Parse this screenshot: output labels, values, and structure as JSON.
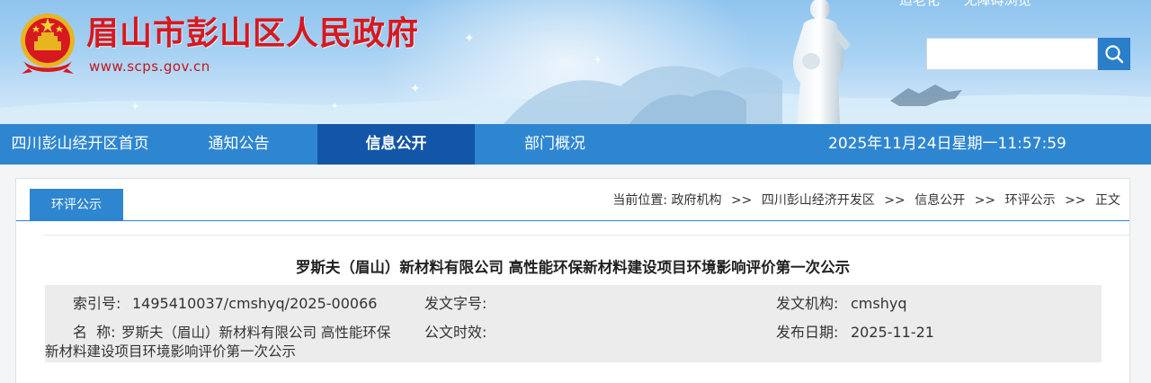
{
  "header": {
    "site_title": "眉山市彭山区人民政府",
    "site_url": "www.scps.gov.cn",
    "top_links": [
      "适老化",
      "无障碍浏览"
    ],
    "search": {
      "value": "",
      "placeholder": ""
    }
  },
  "nav": {
    "items": [
      {
        "label": "四川彭山经开区首页",
        "active": false
      },
      {
        "label": "通知公告",
        "active": false
      },
      {
        "label": "信息公开",
        "active": true
      },
      {
        "label": "部门概况",
        "active": false
      }
    ],
    "datetime": "2025年11月24日星期一11:57:59"
  },
  "content": {
    "tab_label": "环评公示",
    "breadcrumb": {
      "prefix": "当前位置:",
      "items": [
        "政府机构",
        "四川彭山经济开发区",
        "信息公开",
        "环评公示",
        "正文"
      ],
      "separator": ">>"
    },
    "title": "罗斯夫（眉山）新材料有限公司 高性能环保新材料建设项目环境影响评价第一次公示",
    "meta": {
      "index_label": "索引号:",
      "index_value": "1495410037/cmshyq/2025-00066",
      "doc_no_label": "发文字号:",
      "doc_no_value": "",
      "issuer_label": "发文机构:",
      "issuer_value": "cmshyq",
      "name_label": "名  称:",
      "name_value": "罗斯夫（眉山）新材料有限公司 高性能环保新材料建设项目环境影响评价第一次公示",
      "validity_label": "公文时效:",
      "validity_value": "",
      "date_label": "发布日期:",
      "date_value": "2025-11-21"
    }
  },
  "colors": {
    "brand_red": "#d7181f",
    "nav_blue": "#2e86d1",
    "nav_active": "#1356a8",
    "meta_bg": "#ececec"
  },
  "icons": [
    "national-emblem-icon",
    "search-icon"
  ]
}
